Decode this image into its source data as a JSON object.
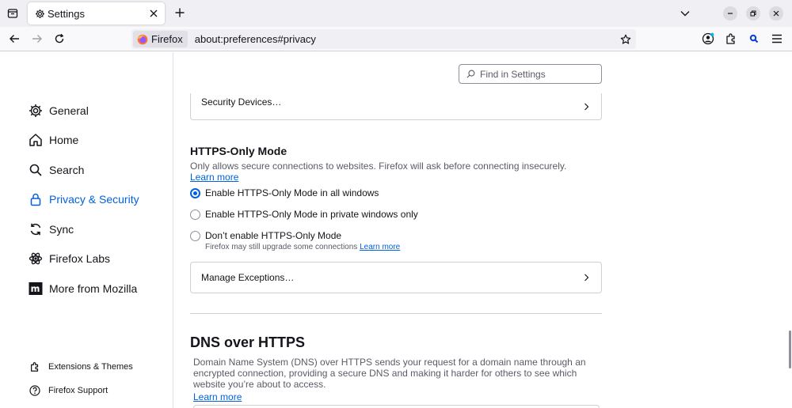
{
  "tab": {
    "title": "Settings"
  },
  "urlbar": {
    "identity_label": "Firefox",
    "url": "about:preferences#privacy"
  },
  "sidebar": {
    "categories": [
      {
        "label": "General"
      },
      {
        "label": "Home"
      },
      {
        "label": "Search"
      },
      {
        "label": "Privacy & Security"
      },
      {
        "label": "Sync"
      },
      {
        "label": "Firefox Labs"
      },
      {
        "label": "More from Mozilla"
      }
    ],
    "footer": [
      {
        "label": "Extensions & Themes"
      },
      {
        "label": "Firefox Support"
      }
    ]
  },
  "search": {
    "placeholder": "Find in Settings"
  },
  "security_devices": {
    "label": "Security Devices…"
  },
  "https_only": {
    "title": "HTTPS-Only Mode",
    "description": "Only allows secure connections to websites. Firefox will ask before connecting insecurely.",
    "learn_more": "Learn more",
    "options": [
      {
        "label": "Enable HTTPS-Only Mode in all windows",
        "checked": true
      },
      {
        "label": "Enable HTTPS-Only Mode in private windows only",
        "checked": false
      },
      {
        "label": "Don’t enable HTTPS-Only Mode",
        "checked": false
      }
    ],
    "note": "Firefox may still upgrade some connections",
    "note_learn_more": "Learn more",
    "manage_exceptions": "Manage Exceptions…"
  },
  "dns": {
    "title": "DNS over HTTPS",
    "description": "Domain Name System (DNS) over HTTPS sends your request for a domain name through an encrypted connection, providing a secure DNS and making it harder for others to see which website you’re about to access.",
    "learn_more": "Learn more"
  },
  "colors": {
    "accent": "#0061e0",
    "text": "#15141a",
    "muted": "#5b5b66",
    "border": "#cfcfd8"
  }
}
